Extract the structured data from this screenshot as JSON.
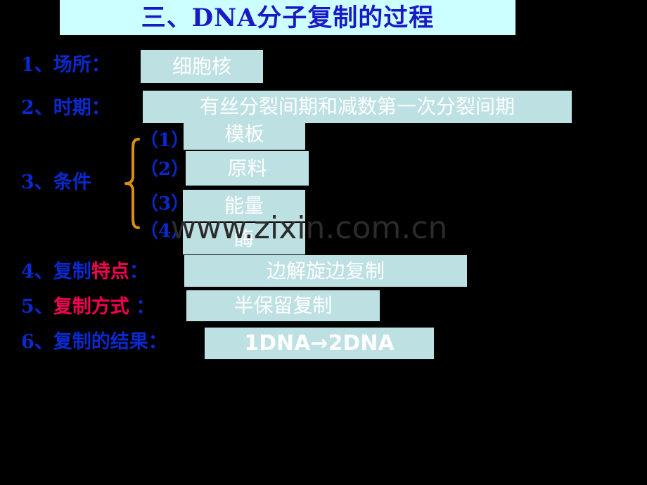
{
  "slide": {
    "background_color": "#000000",
    "title": {
      "text": "三、DNA分子复制的过程",
      "box_color": "#ccffff",
      "text_color": "#1919c8"
    },
    "watermark": "www.zixin.com.cn",
    "accent_colors": {
      "label_blue": "#0a29cf",
      "emphasis_red": "#f50053",
      "answer_box": "#bde0e3",
      "answer_text": "#ffffff",
      "brace_gold": "#d8900f"
    },
    "rows": [
      {
        "number": "1、",
        "label": "场所：",
        "label_parts": [
          {
            "text": "1、场所：",
            "color": "blue"
          }
        ],
        "answer": "细胞核"
      },
      {
        "number": "2、",
        "label": "时期：",
        "label_parts": [
          {
            "text": "2、时期：",
            "color": "blue"
          }
        ],
        "answer": "有丝分裂间期和减数第一次分裂间期"
      },
      {
        "number": "3、",
        "label": "条件",
        "label_parts": [
          {
            "text": "3、条件",
            "color": "blue"
          }
        ],
        "sub_items": [
          {
            "marker": "（1）",
            "answer": "模板"
          },
          {
            "marker": "（2）",
            "answer": "原料"
          },
          {
            "marker": "（3）",
            "answer": "能量"
          },
          {
            "marker": "（4）",
            "answer": "酶"
          }
        ]
      },
      {
        "number": "4、",
        "label": "复制特点：",
        "label_parts": [
          {
            "text": "4、复制",
            "color": "blue"
          },
          {
            "text": "特点",
            "color": "red"
          },
          {
            "text": "：",
            "color": "blue"
          }
        ],
        "answer": "边解旋边复制"
      },
      {
        "number": "5、",
        "label": "复制方式 ：",
        "label_parts": [
          {
            "text": "5、",
            "color": "blue"
          },
          {
            "text": "复制方式",
            "color": "red"
          },
          {
            "text": " ：",
            "color": "blue"
          }
        ],
        "answer": "半保留复制"
      },
      {
        "number": "6、",
        "label": "复制的结果：",
        "label_parts": [
          {
            "text": "6、复制的结果：",
            "color": "blue"
          }
        ],
        "answer": "1DNA→2DNA"
      }
    ]
  }
}
